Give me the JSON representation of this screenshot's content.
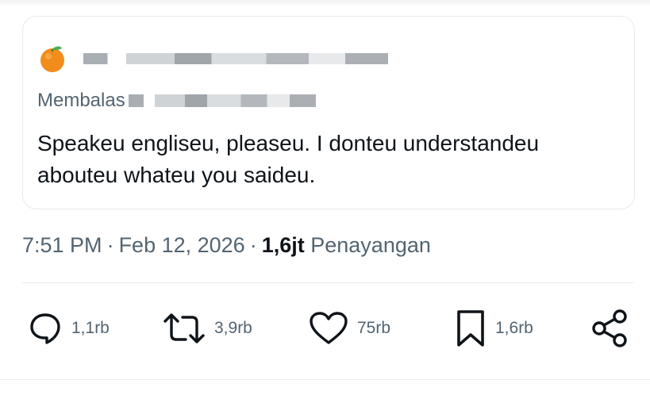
{
  "quoted_post": {
    "reply_prefix": "Membalas",
    "text": "Speakeu engliseu, pleaseu. I donteu understandeu abouteu whateu you saideu.",
    "avatar_icon": "orange-fruit-icon"
  },
  "meta": {
    "time": "7:51 PM",
    "separator": "·",
    "date": "Feb 12, 2026",
    "views_count": "1,6jt",
    "views_label": "Penayangan"
  },
  "actions": {
    "reply_count": "1,1rb",
    "repost_count": "3,9rb",
    "like_count": "75rb",
    "bookmark_count": "1,6rb"
  },
  "colors": {
    "text_primary": "#0f1419",
    "text_secondary": "#536471",
    "border": "#e6e9ec",
    "avatar_orange": "#f28c1a"
  }
}
